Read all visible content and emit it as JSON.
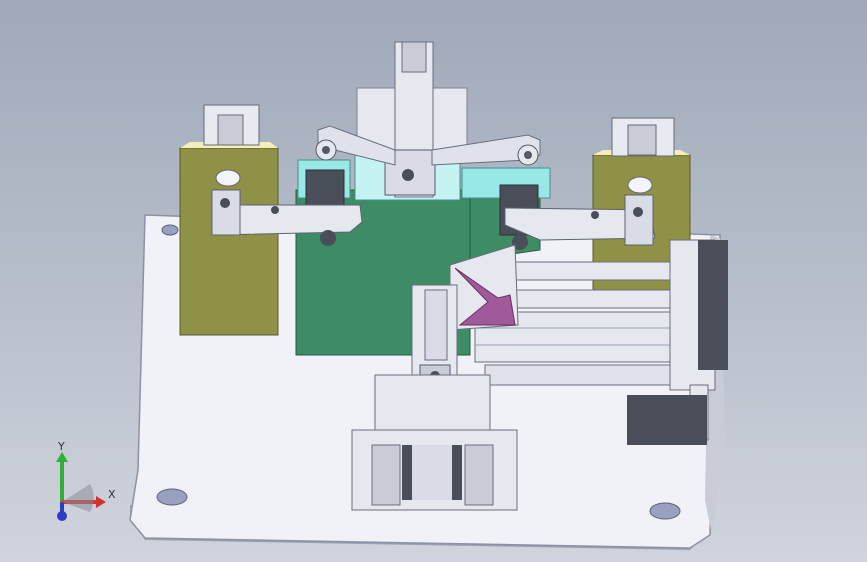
{
  "viewport": {
    "background_top": "#9fa9b9",
    "background_bottom": "#d0d4dc"
  },
  "triad": {
    "x_label": "X",
    "y_label": "Y",
    "x_color": "#d43030",
    "y_color": "#2fae3a",
    "z_color": "#2d3ec4"
  },
  "colors": {
    "base_plate": "#f1f2f8",
    "olive_block": "#8e9146",
    "green_block": "#3d8c66",
    "cyan_part": "#98e8e8",
    "metal_light": "#e6e8f0",
    "metal_dark": "#4a4e58",
    "magenta_part": "#a05a9a"
  }
}
